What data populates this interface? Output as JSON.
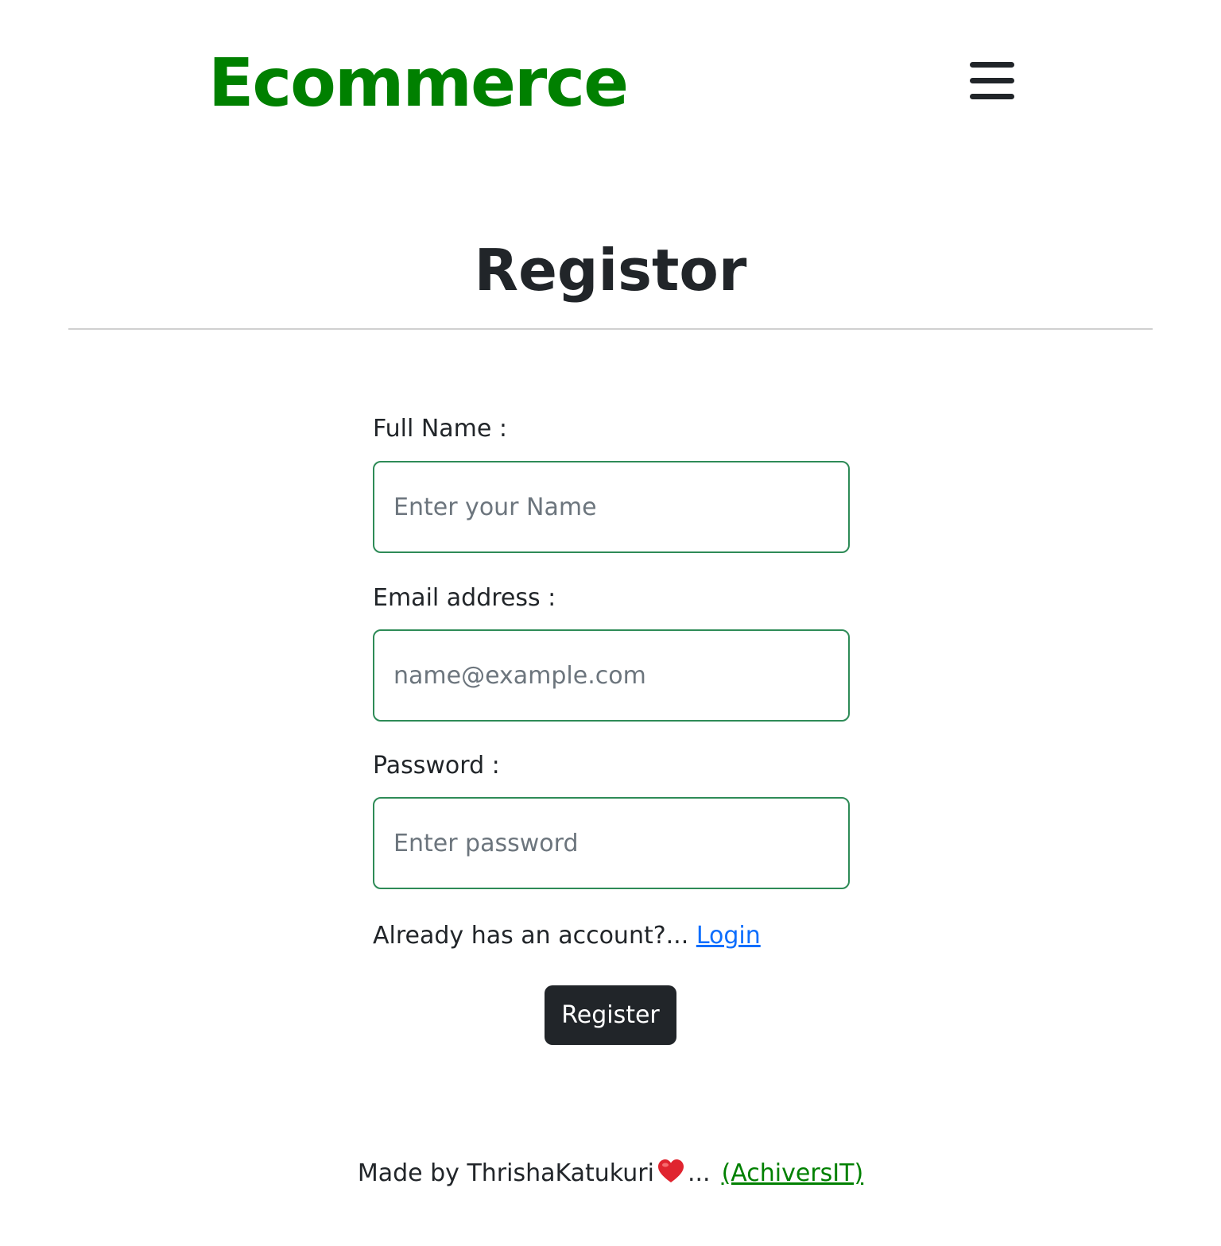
{
  "navbar": {
    "brand": "Ecommerce",
    "menu_icon": "hamburger-menu-icon",
    "brand_color": "#008000"
  },
  "page": {
    "title": "Registor"
  },
  "form": {
    "name_label": "Full Name :",
    "name_placeholder": "Enter your Name",
    "name_value": "",
    "email_label": "Email address :",
    "email_placeholder": "name@example.com",
    "email_value": "",
    "password_label": "Password :",
    "password_placeholder": "Enter password",
    "password_value": "",
    "field_border_color": "#2e8b57",
    "login_prompt": "Already has an account?...",
    "login_link": "Login",
    "submit_label": "Register"
  },
  "footer": {
    "made_by": "Made by ThrishaKatukuri",
    "heart_icon": "heart-icon",
    "ellipsis": "...",
    "link_text": "(AchiversIT)",
    "link_color": "#008000"
  }
}
